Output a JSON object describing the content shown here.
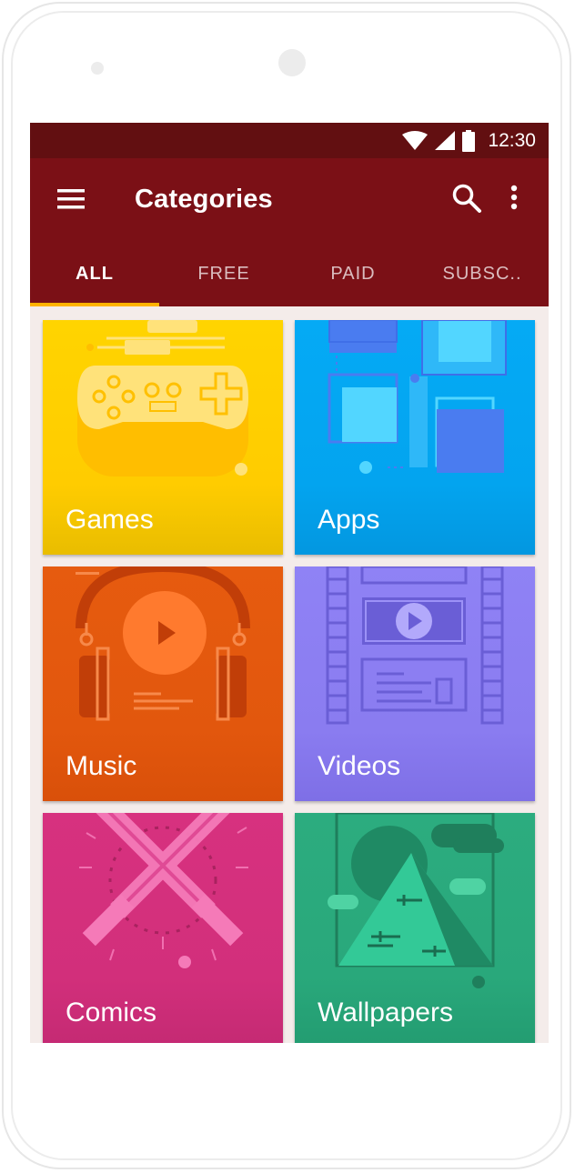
{
  "status_bar": {
    "time": "12:30",
    "icons": [
      "wifi-icon",
      "signal-icon",
      "battery-icon"
    ]
  },
  "app_bar": {
    "title": "Categories",
    "icons": [
      "menu-icon",
      "search-icon",
      "more-vert-icon"
    ],
    "color": "#7b1016",
    "status_color": "#620f11"
  },
  "tabs": [
    {
      "label": "ALL",
      "active": true
    },
    {
      "label": "FREE",
      "active": false
    },
    {
      "label": "PAID",
      "active": false
    },
    {
      "label": "SUBSC..",
      "active": false
    }
  ],
  "tab_indicator_color": "#ffb300",
  "categories": [
    {
      "label": "Games",
      "color": "#ffd000",
      "icon": "gamepad-icon"
    },
    {
      "label": "Apps",
      "color": "#03a9f4",
      "icon": "app-tiles-icon"
    },
    {
      "label": "Music",
      "color": "#e65100",
      "icon": "headphones-icon"
    },
    {
      "label": "Videos",
      "color": "#8c7cf2",
      "icon": "film-strip-icon"
    },
    {
      "label": "Comics",
      "color": "#d6327f",
      "icon": "lightsabers-icon"
    },
    {
      "label": "Wallpapers",
      "color": "#2bab7d",
      "icon": "mountain-icon"
    }
  ]
}
